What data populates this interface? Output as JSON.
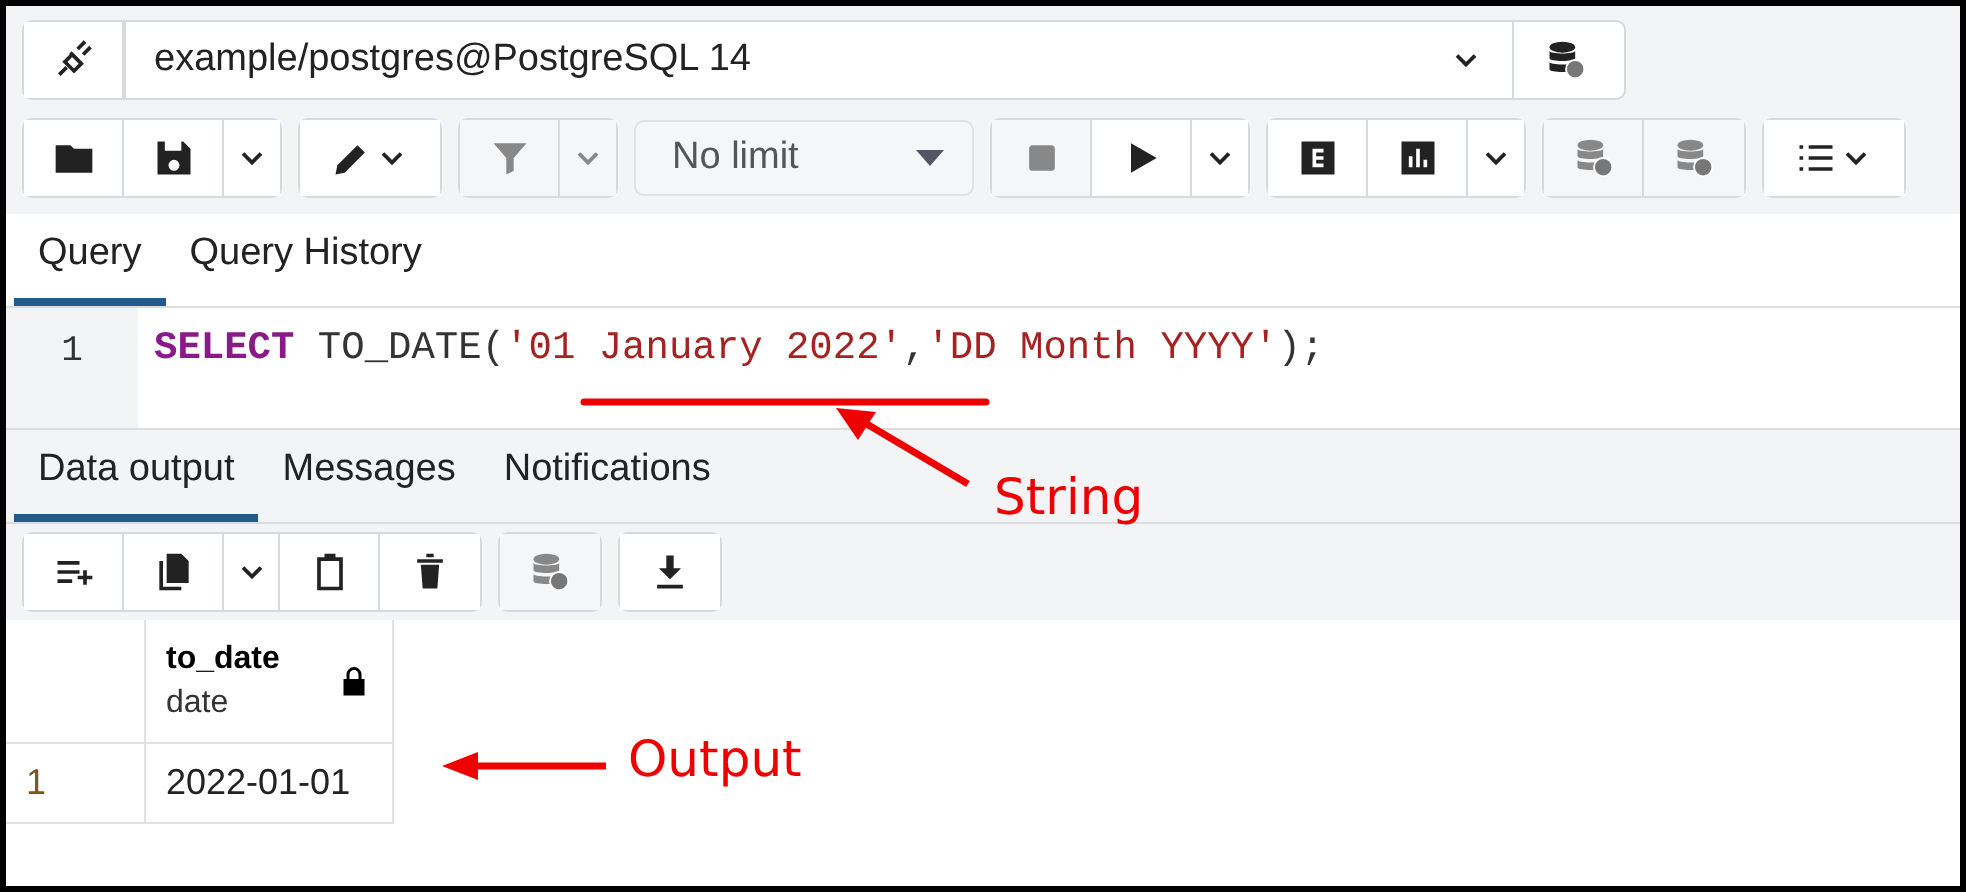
{
  "connection": {
    "label": "example/postgres@PostgreSQL 14"
  },
  "toolbar": {
    "limit": "No limit"
  },
  "query_tabs": [
    {
      "label": "Query",
      "selected": true
    },
    {
      "label": "Query History",
      "selected": false
    }
  ],
  "editor": {
    "lines": [
      {
        "number": "1",
        "tokens": [
          {
            "kind": "keyword",
            "text": "SELECT"
          },
          {
            "kind": "plain",
            "text": " TO_DATE("
          },
          {
            "kind": "string",
            "text": "'01 January 2022'"
          },
          {
            "kind": "plain",
            "text": ","
          },
          {
            "kind": "string",
            "text": "'DD Month YYYY'"
          },
          {
            "kind": "plain",
            "text": ");"
          }
        ]
      }
    ]
  },
  "result_tabs": [
    {
      "label": "Data output",
      "selected": true
    },
    {
      "label": "Messages",
      "selected": false
    },
    {
      "label": "Notifications",
      "selected": false
    }
  ],
  "table": {
    "columns": [
      {
        "name": "to_date",
        "type": "date",
        "locked": true
      }
    ],
    "rows": [
      {
        "number": "1",
        "cells": [
          "2022-01-01"
        ]
      }
    ]
  },
  "annotations": [
    {
      "label": "String"
    },
    {
      "label": "Output"
    }
  ]
}
